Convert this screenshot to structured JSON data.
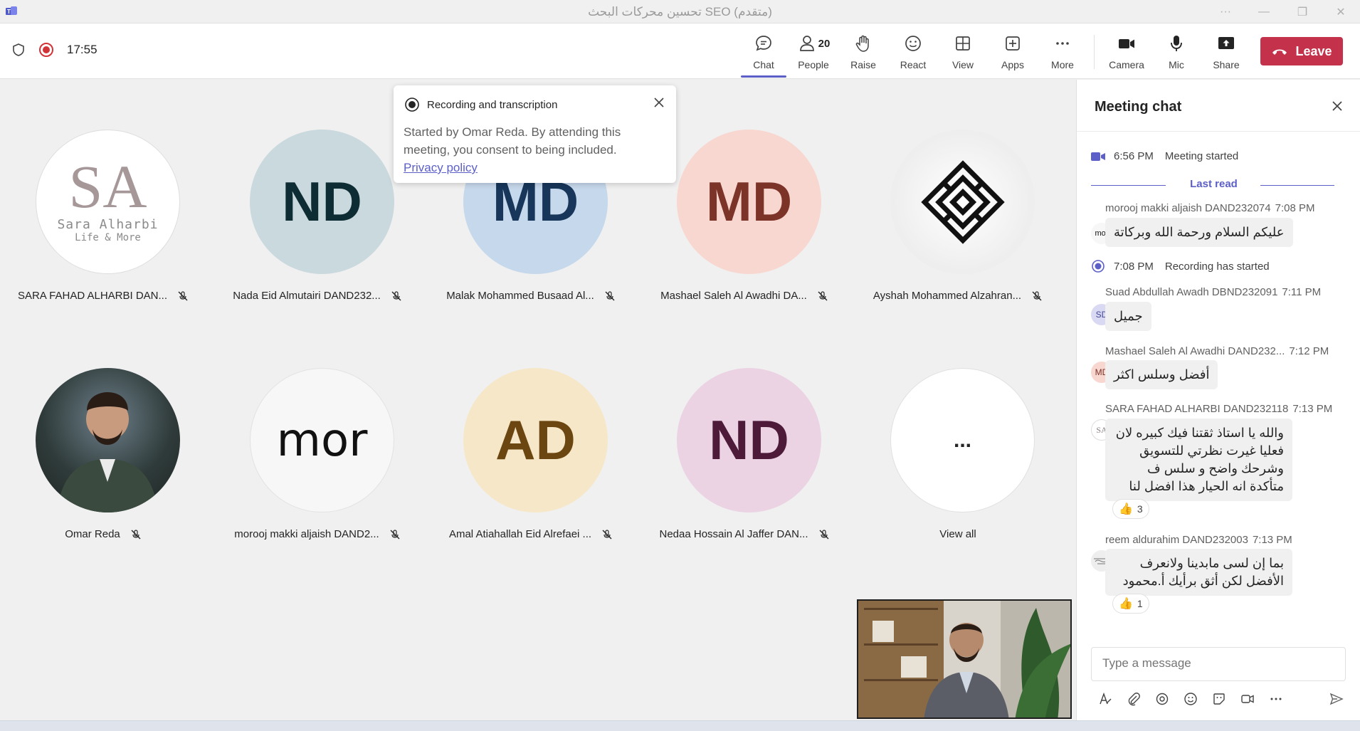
{
  "window": {
    "title": "تحسين محركات البحث SEO (متقدم)"
  },
  "toolbar": {
    "timer": "17:55",
    "chat_label": "Chat",
    "people_label": "People",
    "people_count": "20",
    "raise_label": "Raise",
    "react_label": "React",
    "view_label": "View",
    "apps_label": "Apps",
    "more_label": "More",
    "camera_label": "Camera",
    "mic_label": "Mic",
    "share_label": "Share",
    "leave_label": "Leave"
  },
  "popup": {
    "title": "Recording and transcription",
    "body": "Started by Omar Reda. By attending this meeting, you consent to being included.",
    "link": "Privacy policy"
  },
  "participants": [
    {
      "name": "SARA FAHAD ALHARBI DAN...",
      "avatar_text": "SA",
      "logo_text": "Sara Alharbi",
      "logo_sub": "Life & More"
    },
    {
      "name": "Nada Eid Almutairi DAND232...",
      "avatar_text": "ND"
    },
    {
      "name": "Malak Mohammed Busaad Al...",
      "avatar_text": "MD"
    },
    {
      "name": "Mashael Saleh Al Awadhi DA...",
      "avatar_text": "MD"
    },
    {
      "name": "Ayshah Mohammed Alzahran...",
      "avatar_text": ""
    },
    {
      "name": "Omar Reda",
      "avatar_text": ""
    },
    {
      "name": "morooj makki aljaish DAND2...",
      "avatar_text": "mor"
    },
    {
      "name": "Amal Atiahallah Eid Alrefaei ...",
      "avatar_text": "AD"
    },
    {
      "name": "Nedaa Hossain Al Jaffer DAN...",
      "avatar_text": "ND"
    },
    {
      "name": "View all",
      "avatar_text": "..."
    }
  ],
  "chat": {
    "title": "Meeting chat",
    "meeting_started_time": "6:56 PM",
    "meeting_started_text": "Meeting started",
    "last_read": "Last read",
    "recording_time": "7:08 PM",
    "recording_text": "Recording has started",
    "compose_placeholder": "Type a message",
    "messages": [
      {
        "sender": "morooj makki aljaish DAND232074",
        "time": "7:08 PM",
        "avatar": "mor",
        "text": "عليكم السلام ورحمة الله وبركاتة"
      },
      {
        "sender": "Suad Abdullah Awadh DBND232091",
        "time": "7:11 PM",
        "avatar": "SD",
        "text": "جميل"
      },
      {
        "sender": "Mashael Saleh Al Awadhi DAND232...",
        "time": "7:12 PM",
        "avatar": "MD",
        "text": "أفضل وسلس اكثر"
      },
      {
        "sender": "SARA FAHAD ALHARBI DAND232118",
        "time": "7:13 PM",
        "avatar": "SA",
        "text": "والله يا استاذ ثقتنا فيك كبيره لان فعليا غيرت نظرتي للتسويق وشرحك واضح و سلس ف متأكدة انه الحيار هذا افضل لنا",
        "reaction_count": "3"
      },
      {
        "sender": "reem aldurahim DAND232003",
        "time": "7:13 PM",
        "avatar": "",
        "text": "بما إن لسى مابدينا ولانعرف الأفضل لكن  أثق برأيك أ.محمود",
        "reaction_count": "1"
      }
    ]
  },
  "colors": {
    "accent": "#5b5fc7",
    "leave": "#c4314b",
    "record": "#d13438"
  }
}
